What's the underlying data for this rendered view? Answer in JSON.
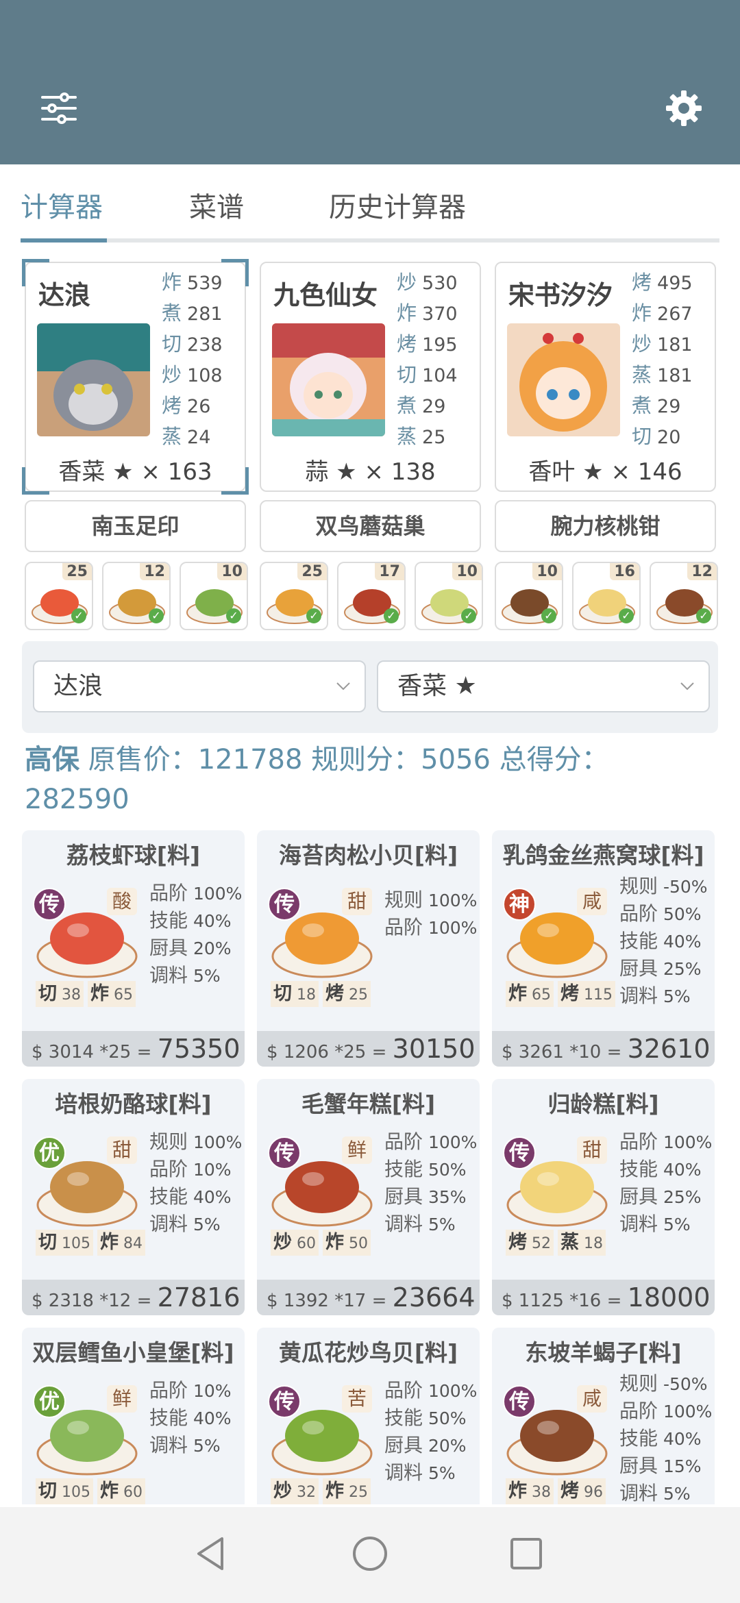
{
  "app": {
    "menu_icon": "sliders-icon",
    "settings_icon": "gear-icon",
    "colors": {
      "topbar": "#5f7c8a",
      "accent": "#5f8fa8",
      "legendary": "#7a3a6a",
      "divine": "#c4462e",
      "fine": "#6aa03a"
    }
  },
  "tabs": [
    {
      "label": "计算器",
      "active": true
    },
    {
      "label": "菜谱",
      "active": false
    },
    {
      "label": "历史计算器",
      "active": false
    }
  ],
  "chefs": [
    {
      "name": "达浪",
      "selected": true,
      "stats": [
        {
          "k": "炸",
          "v": "539"
        },
        {
          "k": "煮",
          "v": "281"
        },
        {
          "k": "切",
          "v": "238"
        },
        {
          "k": "炒",
          "v": "108"
        },
        {
          "k": "烤",
          "v": "26"
        },
        {
          "k": "蒸",
          "v": "24"
        }
      ],
      "ingredient": "香菜 ★ × 163",
      "equip": "南玉足印"
    },
    {
      "name": "九色仙女",
      "selected": false,
      "stats": [
        {
          "k": "炒",
          "v": "530"
        },
        {
          "k": "炸",
          "v": "370"
        },
        {
          "k": "烤",
          "v": "195"
        },
        {
          "k": "切",
          "v": "104"
        },
        {
          "k": "煮",
          "v": "29"
        },
        {
          "k": "蒸",
          "v": "25"
        }
      ],
      "ingredient": "蒜 ★ × 138",
      "equip": "双鸟蘑菇巢"
    },
    {
      "name": "宋书汐汐",
      "selected": false,
      "stats": [
        {
          "k": "烤",
          "v": "495"
        },
        {
          "k": "炸",
          "v": "267"
        },
        {
          "k": "炒",
          "v": "181"
        },
        {
          "k": "蒸",
          "v": "181"
        },
        {
          "k": "煮",
          "v": "29"
        },
        {
          "k": "切",
          "v": "20"
        }
      ],
      "ingredient": "香叶 ★ × 146",
      "equip": "腕力核桃钳"
    }
  ],
  "mini_dishes": [
    {
      "count": "25"
    },
    {
      "count": "12"
    },
    {
      "count": "10"
    },
    {
      "count": "25"
    },
    {
      "count": "17"
    },
    {
      "count": "10"
    },
    {
      "count": "10"
    },
    {
      "count": "16"
    },
    {
      "count": "12"
    }
  ],
  "filters": {
    "chef": "达浪",
    "ingredient": "香菜 ★"
  },
  "summary": {
    "label": "高保",
    "original": "原售价：121788",
    "rule": "规则分：5056",
    "total_label": "总得分：",
    "total": "282590"
  },
  "recipes": [
    {
      "title": "荔枝虾球[料]",
      "rarity": "传",
      "taste": "酸",
      "mods": [
        {
          "k": "品阶",
          "v": "100%"
        },
        {
          "k": "技能",
          "v": "40%"
        },
        {
          "k": "厨具",
          "v": "20%"
        },
        {
          "k": "调料",
          "v": "5%"
        }
      ],
      "req": [
        {
          "k": "切",
          "v": "38"
        },
        {
          "k": "炸",
          "v": "65"
        }
      ],
      "price": "$ 3014 *25  =",
      "total": "75350"
    },
    {
      "title": "海苔肉松小贝[料]",
      "rarity": "传",
      "taste": "甜",
      "mods": [
        {
          "k": "规则",
          "v": "100%"
        },
        {
          "k": "品阶",
          "v": "100%"
        }
      ],
      "req": [
        {
          "k": "切",
          "v": "18"
        },
        {
          "k": "烤",
          "v": "25"
        }
      ],
      "price": "$ 1206 *25  =",
      "total": "30150"
    },
    {
      "title": "乳鸽金丝燕窝球[料]",
      "rarity": "神",
      "taste": "咸",
      "mods": [
        {
          "k": "规则",
          "v": "-50%"
        },
        {
          "k": "品阶",
          "v": "50%"
        },
        {
          "k": "技能",
          "v": "40%"
        },
        {
          "k": "厨具",
          "v": "25%"
        },
        {
          "k": "调料",
          "v": "5%"
        }
      ],
      "req": [
        {
          "k": "炸",
          "v": "65"
        },
        {
          "k": "烤",
          "v": "115"
        }
      ],
      "price": "$ 3261 *10  =",
      "total": "32610"
    },
    {
      "title": "培根奶酪球[料]",
      "rarity": "优",
      "taste": "甜",
      "mods": [
        {
          "k": "规则",
          "v": "100%"
        },
        {
          "k": "品阶",
          "v": "10%"
        },
        {
          "k": "技能",
          "v": "40%"
        },
        {
          "k": "调料",
          "v": "5%"
        }
      ],
      "req": [
        {
          "k": "切",
          "v": "105"
        },
        {
          "k": "炸",
          "v": "84"
        }
      ],
      "price": "$ 2318 *12  =",
      "total": "27816"
    },
    {
      "title": "毛蟹年糕[料]",
      "rarity": "传",
      "taste": "鲜",
      "mods": [
        {
          "k": "品阶",
          "v": "100%"
        },
        {
          "k": "技能",
          "v": "50%"
        },
        {
          "k": "厨具",
          "v": "35%"
        },
        {
          "k": "调料",
          "v": "5%"
        }
      ],
      "req": [
        {
          "k": "炒",
          "v": "60"
        },
        {
          "k": "炸",
          "v": "50"
        }
      ],
      "price": "$ 1392 *17  =",
      "total": "23664"
    },
    {
      "title": "归龄糕[料]",
      "rarity": "传",
      "taste": "甜",
      "mods": [
        {
          "k": "品阶",
          "v": "100%"
        },
        {
          "k": "技能",
          "v": "40%"
        },
        {
          "k": "厨具",
          "v": "25%"
        },
        {
          "k": "调料",
          "v": "5%"
        }
      ],
      "req": [
        {
          "k": "烤",
          "v": "52"
        },
        {
          "k": "蒸",
          "v": "18"
        }
      ],
      "price": "$ 1125 *16  =",
      "total": "18000"
    },
    {
      "title": "双层鳕鱼小皇堡[料]",
      "rarity": "优",
      "taste": "鲜",
      "mods": [
        {
          "k": "品阶",
          "v": "10%"
        },
        {
          "k": "技能",
          "v": "40%"
        },
        {
          "k": "调料",
          "v": "5%"
        }
      ],
      "req": [
        {
          "k": "切",
          "v": "105"
        },
        {
          "k": "炸",
          "v": "60"
        }
      ],
      "price": "",
      "total": ""
    },
    {
      "title": "黄瓜花炒鸟贝[料]",
      "rarity": "传",
      "taste": "苦",
      "mods": [
        {
          "k": "品阶",
          "v": "100%"
        },
        {
          "k": "技能",
          "v": "50%"
        },
        {
          "k": "厨具",
          "v": "20%"
        },
        {
          "k": "调料",
          "v": "5%"
        }
      ],
      "req": [
        {
          "k": "炒",
          "v": "32"
        },
        {
          "k": "炸",
          "v": "25"
        }
      ],
      "price": "",
      "total": ""
    },
    {
      "title": "东坡羊蝎子[料]",
      "rarity": "传",
      "taste": "咸",
      "mods": [
        {
          "k": "规则",
          "v": "-50%"
        },
        {
          "k": "品阶",
          "v": "100%"
        },
        {
          "k": "技能",
          "v": "40%"
        },
        {
          "k": "厨具",
          "v": "15%"
        },
        {
          "k": "调料",
          "v": "5%"
        }
      ],
      "req": [
        {
          "k": "炸",
          "v": "38"
        },
        {
          "k": "烤",
          "v": "96"
        }
      ],
      "price": "",
      "total": ""
    }
  ],
  "navbar": {
    "back_icon": "back-triangle-icon",
    "home_icon": "home-circle-icon",
    "recents_icon": "recents-square-icon"
  }
}
